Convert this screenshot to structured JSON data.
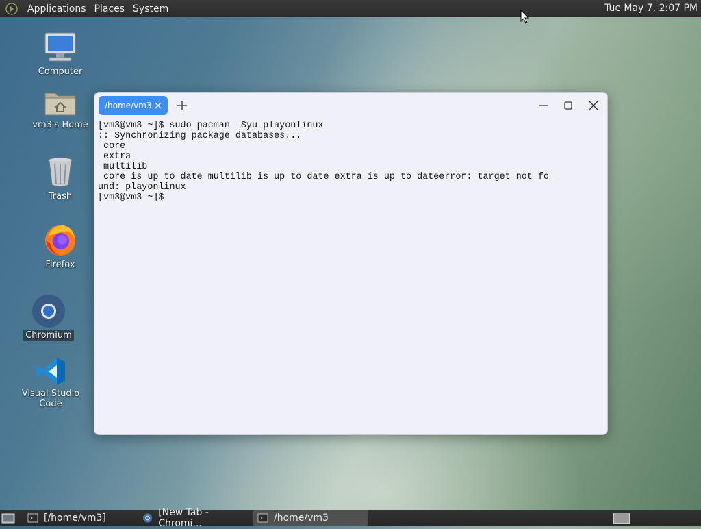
{
  "top_panel": {
    "menus": [
      "Applications",
      "Places",
      "System"
    ],
    "clock": "Tue May 7,  2:07 PM"
  },
  "desktop_icons": [
    {
      "label": "Computer",
      "icon": "computer-icon"
    },
    {
      "label": "vm3's Home",
      "icon": "home-folder-icon"
    },
    {
      "label": "Trash",
      "icon": "trash-icon"
    },
    {
      "label": "Firefox",
      "icon": "firefox-icon"
    },
    {
      "label": "Chromium",
      "icon": "chromium-icon",
      "selected": true
    },
    {
      "label": "Visual Studio Code",
      "icon": "vscode-icon"
    }
  ],
  "terminal": {
    "tab_title": "/home/vm3",
    "lines": [
      "[vm3@vm3 ~]$ sudo pacman -Syu playonlinux",
      ":: Synchronizing package databases...",
      " core",
      " extra",
      " multilib",
      " core is up to date multilib is up to date extra is up to dateerror: target not fo",
      "und: playonlinux",
      "[vm3@vm3 ~]$"
    ]
  },
  "taskbar": {
    "tasks": [
      {
        "label": "[/home/vm3]",
        "icon": "terminal-icon",
        "active": false
      },
      {
        "label": "[New Tab - Chromi...",
        "icon": "chromium-icon",
        "active": false
      },
      {
        "label": "/home/vm3",
        "icon": "terminal-icon",
        "active": true
      }
    ]
  },
  "colors": {
    "tab_accent": "#3d8ef0",
    "terminal_bg": "#eff0f8",
    "panel_bg": "#2b2b2b"
  }
}
